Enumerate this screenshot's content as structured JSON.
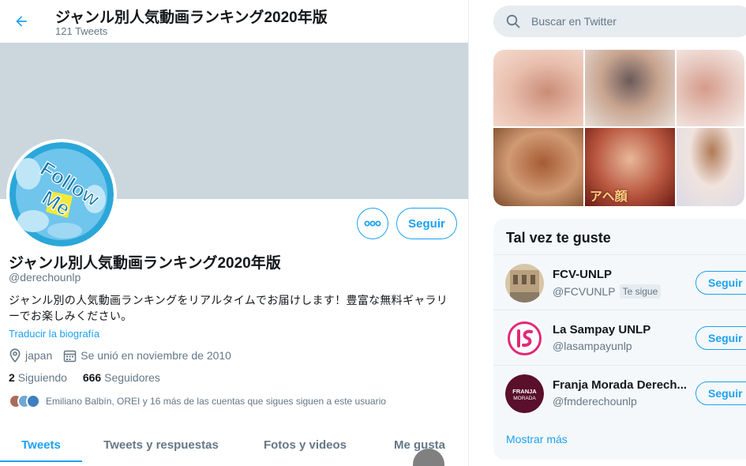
{
  "header": {
    "title": "ジャンル別人気動画ランキング2020年版",
    "tweets_count": "121 Tweets"
  },
  "profile": {
    "avatar_text": [
      "Follow",
      "Me"
    ],
    "name": "ジャンル別人気動画ランキング2020年版",
    "handle": "@derechounlp",
    "bio": "ジャンル別の人気動画ランキングをリアルタイムでお届けします！豊富な無料ギャラリーでお楽しみください。",
    "translate_label": "Traducir la biografía",
    "location": "japan",
    "joined": "Se unió en noviembre de 2010",
    "following_count": "2",
    "following_label": "Siguiendo",
    "followers_count": "666",
    "followers_label": "Seguidores",
    "followers_you_know": "Emiliano Balbín, OREI y 16 más de las cuentas que sigues siguen a este usuario",
    "follow_label": "Seguir"
  },
  "tabs": [
    {
      "label": "Tweets",
      "active": true
    },
    {
      "label": "Tweets y respuestas",
      "active": false
    },
    {
      "label": "Fotos y videos",
      "active": false
    },
    {
      "label": "Me gusta",
      "active": false
    }
  ],
  "search": {
    "placeholder": "Buscar en Twitter"
  },
  "media": {
    "caption": "アヘ顔",
    "tiles": [
      "#e9bfae",
      "#c8a48f",
      "#e7c9c0",
      "#d09a73",
      "#b8563f",
      "#f1e3de"
    ]
  },
  "suggestions": {
    "title": "Tal vez te guste",
    "items": [
      {
        "name": "FCV-UNLP",
        "handle": "@FCVUNLP",
        "follows_you": "Te sigue",
        "follow_label": "Seguir"
      },
      {
        "name": "La Sampay UNLP",
        "handle": "@lasampayunlp",
        "follows_you": "",
        "follow_label": "Seguir"
      },
      {
        "name": "Franja Morada Derech...",
        "handle": "@fmderechounlp",
        "follows_you": "",
        "follow_label": "Seguir",
        "avatar_text": [
          "FRANJA",
          "MORADA"
        ]
      }
    ],
    "show_more": "Mostrar más"
  },
  "colors": {
    "accent": "#1da1f2",
    "banner": "#ccd6dd",
    "secondary_text": "#657786"
  }
}
